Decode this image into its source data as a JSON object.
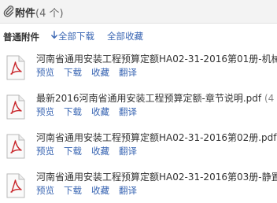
{
  "header": {
    "title": "附件",
    "count": "(4 个)"
  },
  "toolbar": {
    "section_label": "普通附件",
    "download_all": "全部下载",
    "favorite_all": "全部收藏"
  },
  "files": [
    {
      "name": "河南省通用安装工程预算定额HA02-31-2016第01册-机械",
      "size": "",
      "actions": {
        "preview": "预览",
        "download": "下载",
        "favorite": "收藏",
        "translate": "翻译"
      }
    },
    {
      "name": "最新2016河南省通用安装工程预算定额-章节说明.pdf",
      "size": " (4",
      "actions": {
        "preview": "预览",
        "download": "下载",
        "favorite": "收藏",
        "translate": "翻译"
      }
    },
    {
      "name": "河南省通用安装工程预算定额HA02-31-2016第02册.pdf",
      "size": "",
      "actions": {
        "preview": "预览",
        "download": "下载",
        "favorite": "收藏",
        "translate": "翻译"
      }
    },
    {
      "name": "河南省通用安装工程预算定额HA02-31-2016第03册-静置",
      "size": "",
      "actions": {
        "preview": "预览",
        "download": "下载",
        "favorite": "收藏",
        "translate": "翻译"
      }
    }
  ],
  "colors": {
    "link": "#3a66b3",
    "header_bg": "#f3f3f3",
    "pdf_red": "#c8262b"
  },
  "icons": {
    "attachment": "paperclip-icon",
    "download": "down-arrow-icon",
    "file": "pdf-file-icon"
  }
}
